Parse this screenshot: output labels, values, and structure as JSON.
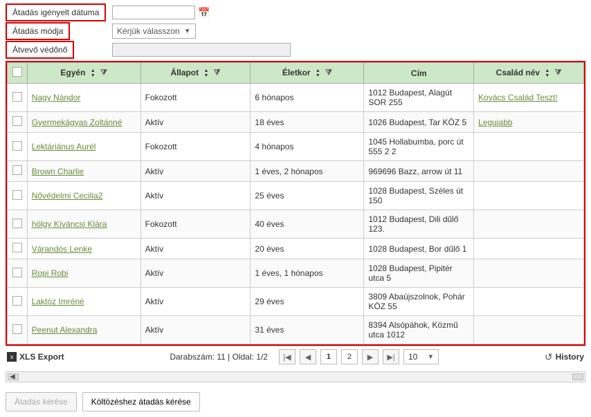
{
  "form": {
    "date_label": "Átadás igényelt dátuma",
    "date_value": "",
    "mode_label": "Átadás módja",
    "mode_selected": "Kérjük válasszon",
    "receiver_label": "Átvevő védőnő",
    "receiver_value": ""
  },
  "table": {
    "headers": {
      "name": "Egyén",
      "status": "Állapot",
      "age": "Életkor",
      "address": "Cím",
      "family": "Család név"
    },
    "rows": [
      {
        "name": "Nagy Nándor",
        "status": "Fokozott",
        "age": "6 hónapos",
        "address": "1012 Budapest, Alagút SOR 255",
        "family": "Kovács Család Teszt!"
      },
      {
        "name": "Gyermekágyas Zoltánné",
        "status": "Aktív",
        "age": "18 éves",
        "address": "1026 Budapest, Tar KÖZ 5",
        "family": "Legujabb"
      },
      {
        "name": "Lektáriánus Aurél",
        "status": "Fokozott",
        "age": "4 hónapos",
        "address": "1045 Hollabumba, porc út 555 2 2",
        "family": ""
      },
      {
        "name": "Brown Charlie",
        "status": "Aktív",
        "age": "1 éves, 2 hónapos",
        "address": "969696 Bazz, arrow út 11",
        "family": ""
      },
      {
        "name": "Nővédelmi Cecilia2",
        "status": "Aktív",
        "age": "25 éves",
        "address": "1028 Budapest, Széles út 150",
        "family": ""
      },
      {
        "name": "hölgy Kíváncsi Klára",
        "status": "Fokozott",
        "age": "40 éves",
        "address": "1012 Budapest, Dili dűlő 123.",
        "family": ""
      },
      {
        "name": "Várandós Lenke",
        "status": "Aktív",
        "age": "20 éves",
        "address": "1028 Budapest, Bor dűlő 1",
        "family": ""
      },
      {
        "name": "Ropi Robi",
        "status": "Aktív",
        "age": "1 éves, 1 hónapos",
        "address": "1028 Budapest, Pipitér utca 5",
        "family": ""
      },
      {
        "name": "Laktóz Imréné",
        "status": "Aktív",
        "age": "29 éves",
        "address": "3809 Abaújszolnok, Pohár KÖZ 55",
        "family": ""
      },
      {
        "name": "Peenut Alexandra",
        "status": "Aktív",
        "age": "31 éves",
        "address": "8394 Alsópáhok, Közmű utca 1012",
        "family": ""
      }
    ]
  },
  "footer": {
    "xls_label": "XLS Export",
    "count_label": "Darabszám: 11 | Oldal: 1/2",
    "pages": [
      "1",
      "2"
    ],
    "page_size": "10",
    "history_label": "History"
  },
  "actions": {
    "submit": "Átadás kérése",
    "move_submit": "Költözéshez átadás kérése"
  }
}
